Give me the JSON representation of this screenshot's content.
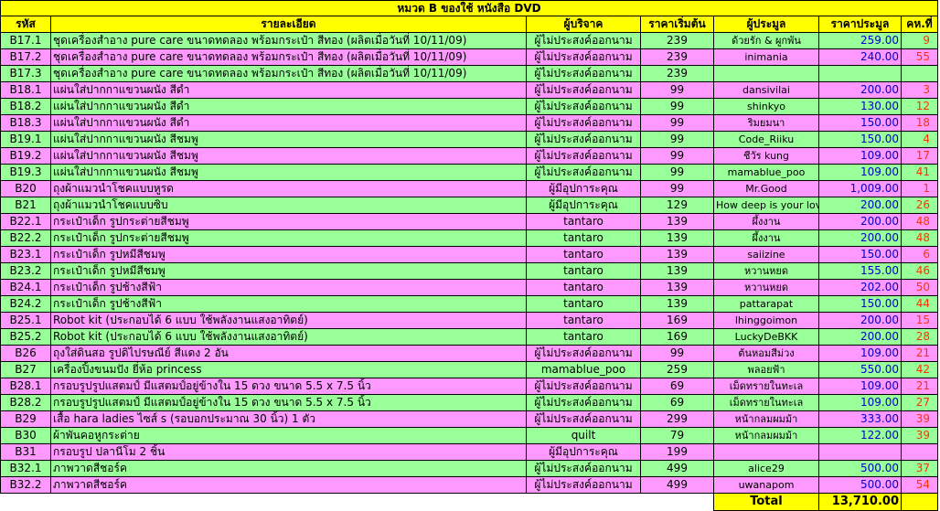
{
  "title": "หมวด B ของใช้ หนังสือ DVD",
  "headers": {
    "code": "รหัส",
    "detail": "รายละเอียด",
    "donor": "ผู้บริจาค",
    "start": "ราคาเริ่มต้น",
    "bidder": "ผู้ประมูล",
    "price": "ราคาประมูล",
    "count": "คห.ที่"
  },
  "rows": [
    {
      "code": "B17.1",
      "detail": "ชุดเครื่องสำอาง pure care ขนาดทดลอง พร้อมกระเป๋า สีทอง (ผลิตเมื่อวันที่ 10/11/09)",
      "donor": "ผู้ไม่ประสงค์ออกนาม",
      "start": "239",
      "bidder": "ด้วยรัก & ผูกพัน",
      "price": "259.00",
      "count": "9"
    },
    {
      "code": "B17.2",
      "detail": "ชุดเครื่องสำอาง pure care ขนาดทดลอง พร้อมกระเป๋า สีทอง (ผลิตเมื่อวันที่ 10/11/09)",
      "donor": "ผู้ไม่ประสงค์ออกนาม",
      "start": "239",
      "bidder": "inimania",
      "price": "240.00",
      "count": "55"
    },
    {
      "code": "B17.3",
      "detail": "ชุดเครื่องสำอาง pure care ขนาดทดลอง พร้อมกระเป๋า สีทอง (ผลิตเมื่อวันที่ 10/11/09)",
      "donor": "ผู้ไม่ประสงค์ออกนาม",
      "start": "239",
      "bidder": "",
      "price": "",
      "count": ""
    },
    {
      "code": "B18.1",
      "detail": "แผ่นใส่ปากกาแขวนผนัง สีดำ",
      "donor": "ผู้ไม่ประสงค์ออกนาม",
      "start": "99",
      "bidder": "dansivilai",
      "price": "200.00",
      "count": "3"
    },
    {
      "code": "B18.2",
      "detail": "แผ่นใส่ปากกาแขวนผนัง สีดำ",
      "donor": "ผู้ไม่ประสงค์ออกนาม",
      "start": "99",
      "bidder": "shinkyo",
      "price": "130.00",
      "count": "12"
    },
    {
      "code": "B18.3",
      "detail": "แผ่นใส่ปากกาแขวนผนัง สีดำ",
      "donor": "ผู้ไม่ประสงค์ออกนาม",
      "start": "99",
      "bidder": "ริมยมนา",
      "price": "150.00",
      "count": "18"
    },
    {
      "code": "B19.1",
      "detail": "แผ่นใส่ปากกาแขวนผนัง สีชมพู",
      "donor": "ผู้ไม่ประสงค์ออกนาม",
      "start": "99",
      "bidder": "Code_Riiku",
      "price": "150.00",
      "count": "4"
    },
    {
      "code": "B19.2",
      "detail": "แผ่นใส่ปากกาแขวนผนัง สีชมพู",
      "donor": "ผู้ไม่ประสงค์ออกนาม",
      "start": "99",
      "bidder": "ชีวัร kung",
      "price": "109.00",
      "count": "17"
    },
    {
      "code": "B19.3",
      "detail": "แผ่นใส่ปากกาแขวนผนัง สีชมพู",
      "donor": "ผู้ไม่ประสงค์ออกนาม",
      "start": "99",
      "bidder": "mamablue_poo",
      "price": "109.00",
      "count": "41"
    },
    {
      "code": "B20",
      "detail": "ถุงผ้าแมวนำโชคแบบหูรด",
      "donor": "ผู้มีอุปการะคุณ",
      "start": "99",
      "bidder": "Mr.Good",
      "price": "1,009.00",
      "count": "1"
    },
    {
      "code": "B21",
      "detail": "ถุงผ้าแมวนำโชคแบบซิบ",
      "donor": "ผู้มีอุปการะคุณ",
      "start": "129",
      "bidder": "How deep is your love",
      "price": "200.00",
      "count": "26"
    },
    {
      "code": "B22.1",
      "detail": "กระเป๋าเด็ก รูปกระต่ายสีชมพู",
      "donor": "tantaro",
      "start": "139",
      "bidder": "ผึ้งงาน",
      "price": "200.00",
      "count": "48"
    },
    {
      "code": "B22.2",
      "detail": "กระเป๋าเด็ก รูปกระต่ายสีชมพู",
      "donor": "tantaro",
      "start": "139",
      "bidder": "ผึ้งงาน",
      "price": "200.00",
      "count": "48"
    },
    {
      "code": "B23.1",
      "detail": "กระเป๋าเด็ก รูปหมีสีชมพู",
      "donor": "tantaro",
      "start": "139",
      "bidder": "saiizine",
      "price": "150.00",
      "count": "6"
    },
    {
      "code": "B23.2",
      "detail": "กระเป๋าเด็ก รูปหมีสีชมพู",
      "donor": "tantaro",
      "start": "139",
      "bidder": "หวานหยด",
      "price": "155.00",
      "count": "46"
    },
    {
      "code": "B24.1",
      "detail": "กระเป๋าเด็ก รูปช้างสีฟ้า",
      "donor": "tantaro",
      "start": "139",
      "bidder": "หวานหยด",
      "price": "202.00",
      "count": "50"
    },
    {
      "code": "B24.2",
      "detail": "กระเป๋าเด็ก รูปช้างสีฟ้า",
      "donor": "tantaro",
      "start": "139",
      "bidder": "pattarapat",
      "price": "150.00",
      "count": "44"
    },
    {
      "code": "B25.1",
      "detail": "Robot kit (ประกอบได้ 6 แบบ ใช้พลังงานแสงอาทิตย์)",
      "donor": "tantaro",
      "start": "169",
      "bidder": "lhinggoimon",
      "price": "200.00",
      "count": "15"
    },
    {
      "code": "B25.2",
      "detail": "Robot kit (ประกอบได้ 6 แบบ ใช้พลังงานแสงอาทิตย์)",
      "donor": "tantaro",
      "start": "169",
      "bidder": "LuckyDeBKK",
      "price": "200.00",
      "count": "28"
    },
    {
      "code": "B26",
      "detail": "ถุงใส่ดินสอ รูปดิไปรษณีย์ สีแดง 2 อัน",
      "donor": "ผู้ไม่ประสงค์ออกนาม",
      "start": "99",
      "bidder": "ต้นหอมสีม่วง",
      "price": "109.00",
      "count": "21"
    },
    {
      "code": "B27",
      "detail": "เครื่องปิ้งขนมปัง ยี่ห้อ princess",
      "donor": "mamablue_poo",
      "start": "259",
      "bidder": "พลอยฟ้า",
      "price": "550.00",
      "count": "42"
    },
    {
      "code": "B28.1",
      "detail": "กรอบรูปรูปแสตมป์ มีแสตมป์อยู่ข้างใน 15 ดวง ขนาด 5.5 x 7.5 นิ้ว",
      "donor": "ผู้ไม่ประสงค์ออกนาม",
      "start": "69",
      "bidder": "เม็ดทรายในทะเล",
      "price": "109.00",
      "count": "21"
    },
    {
      "code": "B28.2",
      "detail": "กรอบรูปรูปแสตมป์ มีแสตมป์อยู่ข้างใน 15 ดวง ขนาด 5.5 x 7.5 นิ้ว",
      "donor": "ผู้ไม่ประสงค์ออกนาม",
      "start": "69",
      "bidder": "เม็ดทรายในทะเล",
      "price": "109.00",
      "count": "27"
    },
    {
      "code": "B29",
      "detail": "เสื้อ hara ladies ไซส์ s (รอบอกประมาณ 30 นิ้ว) 1 ตัว",
      "donor": "ผู้ไม่ประสงค์ออกนาม",
      "start": "299",
      "bidder": "หน้ากลมผมม้า",
      "price": "333.00",
      "count": "39"
    },
    {
      "code": "B30",
      "detail": "ผ้าพันคอหูกระต่าย",
      "donor": "quilt",
      "start": "79",
      "bidder": "หน้ากลมผมม้า",
      "price": "122.00",
      "count": "39"
    },
    {
      "code": "B31",
      "detail": "กรอบรูป ปลานีโม 2 ชิ้น",
      "donor": "ผู้มีอุปการะคุณ",
      "start": "199",
      "bidder": "",
      "price": "",
      "count": ""
    },
    {
      "code": "B32.1",
      "detail": "ภาพวาดสีชอร์ค",
      "donor": "ผู้ไม่ประสงค์ออกนาม",
      "start": "499",
      "bidder": "alice29",
      "price": "500.00",
      "count": "37"
    },
    {
      "code": "B32.2",
      "detail": "ภาพวาดสีชอร์ค",
      "donor": "ผู้ไม่ประสงค์ออกนาม",
      "start": "499",
      "bidder": "uwanapom",
      "price": "500.00",
      "count": "54"
    }
  ],
  "row_colors": [
    "g",
    "p",
    "g",
    "p",
    "g",
    "p",
    "g",
    "p",
    "g",
    "p",
    "g",
    "p",
    "g",
    "p",
    "g",
    "p",
    "g",
    "p",
    "g",
    "p",
    "g",
    "p",
    "g",
    "p",
    "g",
    "p",
    "g",
    "p"
  ],
  "total": {
    "label": "Total",
    "amount": "13,710.00"
  }
}
